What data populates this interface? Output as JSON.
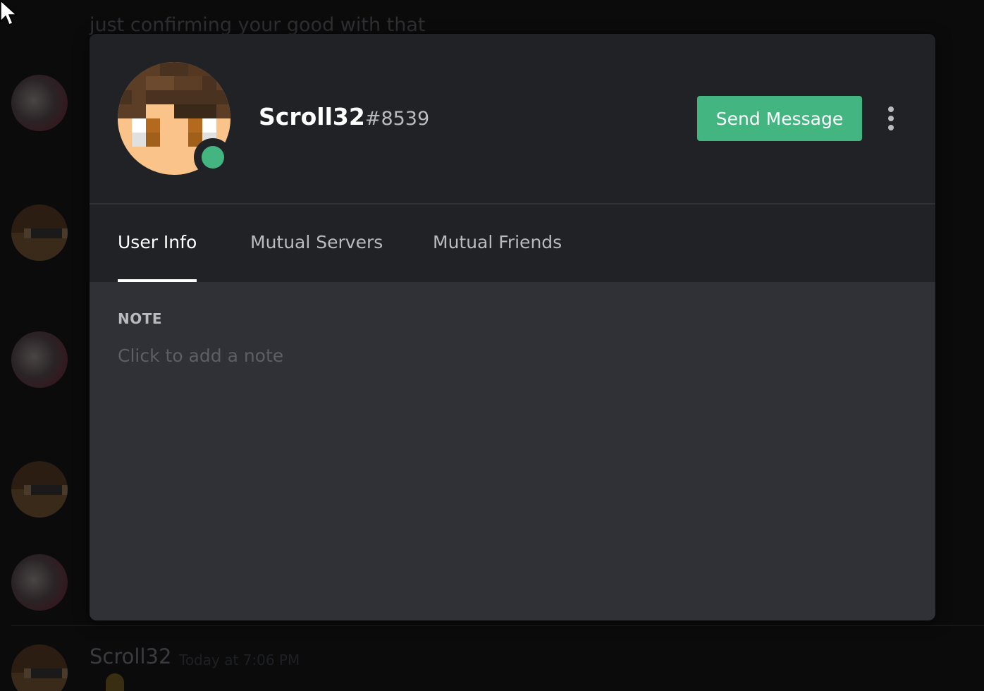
{
  "background": {
    "chat_message": "just confirming your good with that",
    "author": "Scroll32",
    "timestamp": "Today at 7:06 PM"
  },
  "profile": {
    "username": "Scroll32",
    "discriminator": "#8539",
    "status": "online",
    "status_color": "#43b581"
  },
  "actions": {
    "send_message_label": "Send Message",
    "more_icon": "vertical-ellipsis-icon"
  },
  "tabs": [
    {
      "label": "User Info",
      "active": true
    },
    {
      "label": "Mutual Servers",
      "active": false
    },
    {
      "label": "Mutual Friends",
      "active": false
    }
  ],
  "note": {
    "label": "NOTE",
    "placeholder": "Click to add a note",
    "value": ""
  },
  "colors": {
    "accent_green": "#43b581",
    "modal_header": "#202225",
    "modal_body": "#2f3136"
  }
}
